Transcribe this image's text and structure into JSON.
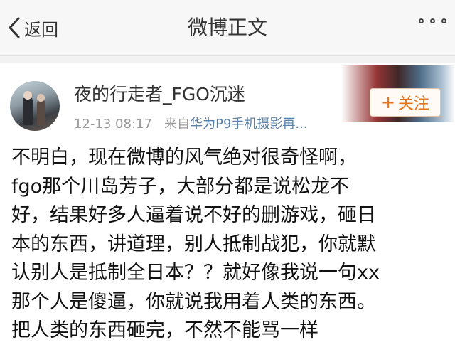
{
  "header": {
    "back_label": "返回",
    "title": "微博正文"
  },
  "post": {
    "username": "夜的行走者_FGO沉迷",
    "time": "12-13 08:17",
    "source_prefix": "来自",
    "source_name": "华为P9手机摄影再...",
    "follow_label": "关注",
    "content_lines": [
      "不明白，现在微博的风气绝对很奇怪啊，",
      "fgo那个川岛芳子，大部分都是说松龙不",
      "好，结果好多人逼着说不好的删游戏，砸日",
      "本的东西，讲道理，别人抵制战犯，你就默",
      "认别人是抵制全日本？？就好像我说一句xx",
      "那个人是傻逼，你就说我用着人类的东西。",
      "把人类的东西砸完，不然不能骂一样"
    ]
  },
  "colors": {
    "accent_orange": "#e8741a",
    "link_blue": "#5b7fa6"
  },
  "icons": [
    "back-chevron-icon",
    "more-dots-icon",
    "plus-icon"
  ]
}
